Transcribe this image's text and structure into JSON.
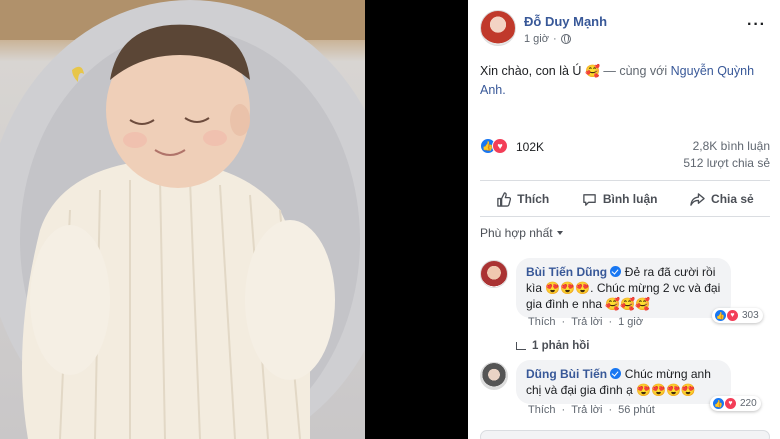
{
  "post": {
    "author": "Đỗ Duy Mạnh",
    "time": "1 giờ",
    "text": {
      "main": "Xin chào, con là Ú",
      "emoji": "🥰",
      "with_prefix": "— cùng với",
      "tagged": "Nguyễn Quỳnh Anh."
    },
    "reaction_count": "102K",
    "comments_count": "2,8K bình luận",
    "shares_count": "512 lượt chia sẻ",
    "actions": {
      "like": "Thích",
      "comment": "Bình luận",
      "share": "Chia sẻ"
    },
    "sort_label": "Phù hợp nhất"
  },
  "comments": [
    {
      "author": "Bùi Tiến Dũng",
      "text": "Đẻ ra đã cười rồi kìa 😍😍😍. Chúc mừng 2 vc và đại gia đình e nha 🥰🥰🥰",
      "like_label": "Thích",
      "reply_label": "Trả lời",
      "time": "1 giờ",
      "reaction_count": "303"
    },
    {
      "author": "Dũng Bùi Tiến",
      "text": "Chúc mừng anh chị và đại gia đình ạ 😍😍😍😍",
      "like_label": "Thích",
      "reply_label": "Trả lời",
      "time": "56 phút",
      "reaction_count": "220"
    }
  ],
  "replies_link": "1 phản hồi",
  "colors": {
    "link": "#385898",
    "like": "#1877f2",
    "love": "#f33e58"
  }
}
